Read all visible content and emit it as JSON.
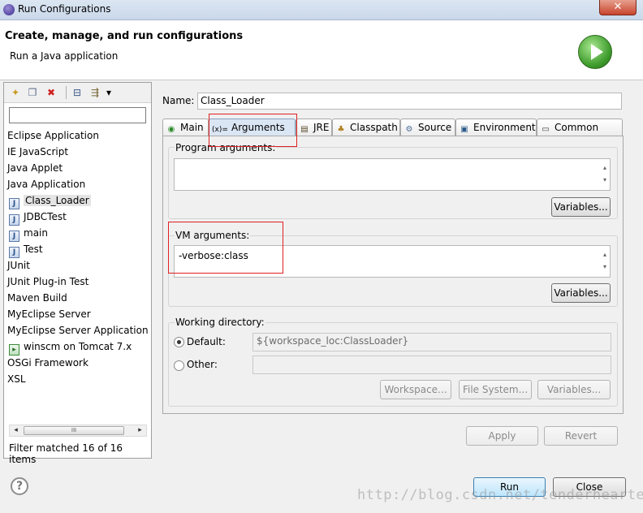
{
  "window": {
    "title": "Run Configurations",
    "close_glyph": "✕",
    "close_icon": "close-icon"
  },
  "banner": {
    "heading": "Create, manage, and run configurations",
    "subtitle": "Run a Java application",
    "icon": "run-icon"
  },
  "left_toolbar": {
    "new_glyph": "✦",
    "duplicate_glyph": "❐",
    "delete_glyph": "✖",
    "collapse_glyph": "⊟",
    "filter_glyph": "⇶",
    "dropdown_glyph": "▾"
  },
  "filter_input": {
    "value": "",
    "placeholder": ""
  },
  "tree": [
    {
      "label": "Eclipse Application",
      "icon": null,
      "selected": false
    },
    {
      "label": "IE JavaScript",
      "icon": null,
      "selected": false
    },
    {
      "label": "Java Applet",
      "icon": null,
      "selected": false
    },
    {
      "label": "Java Application",
      "icon": null,
      "selected": false
    },
    {
      "label": "Class_Loader",
      "icon": "java-class-icon",
      "selected": true
    },
    {
      "label": "JDBCTest",
      "icon": "java-class-icon",
      "selected": false
    },
    {
      "label": "main",
      "icon": "java-class-icon",
      "selected": false
    },
    {
      "label": "Test",
      "icon": "java-class-icon",
      "selected": false
    },
    {
      "label": "JUnit",
      "icon": null,
      "selected": false
    },
    {
      "label": "JUnit Plug-in Test",
      "icon": null,
      "selected": false
    },
    {
      "label": "Maven Build",
      "icon": null,
      "selected": false
    },
    {
      "label": "MyEclipse Server",
      "icon": null,
      "selected": false
    },
    {
      "label": "MyEclipse Server Application",
      "icon": null,
      "selected": false
    },
    {
      "label": "winscm on Tomcat  7.x",
      "icon": "server-icon",
      "selected": false
    },
    {
      "label": "OSGi Framework",
      "icon": null,
      "selected": false
    },
    {
      "label": "XSL",
      "icon": null,
      "selected": false
    }
  ],
  "scrollbar": {
    "left_arrow": "◂",
    "right_arrow": "▸",
    "thumb_grip": "III"
  },
  "filter_status": "Filter matched 16 of 16 items",
  "name_field": {
    "label": "Name:",
    "value": "Class_Loader"
  },
  "tabs": [
    {
      "label": "Main",
      "icon_glyph": "◉",
      "icon": "main-icon",
      "active": false
    },
    {
      "label": "Arguments",
      "icon_glyph": "(x)=",
      "icon": "arguments-icon",
      "active": true
    },
    {
      "label": "JRE",
      "icon_glyph": "▤",
      "icon": "jre-icon",
      "active": false
    },
    {
      "label": "Classpath",
      "icon_glyph": "♣",
      "icon": "classpath-icon",
      "active": false
    },
    {
      "label": "Source",
      "icon_glyph": "⚙",
      "icon": "source-icon",
      "active": false
    },
    {
      "label": "Environment",
      "icon_glyph": "▣",
      "icon": "environment-icon",
      "active": false
    },
    {
      "label": "Common",
      "icon_glyph": "▭",
      "icon": "common-icon",
      "active": false
    }
  ],
  "arguments": {
    "program_label": "Program arguments:",
    "program_value": "",
    "program_variables_button": "Variables...",
    "vm_label": "VM arguments:",
    "vm_value": "-verbose:class",
    "vm_variables_button": "Variables...",
    "scroll_up": "▴",
    "scroll_down": "▾"
  },
  "working_directory": {
    "label": "Working directory:",
    "default_label": "Default:",
    "default_value": "${workspace_loc:ClassLoader}",
    "other_label": "Other:",
    "other_value": "",
    "selected": "default",
    "workspace_button": "Workspace...",
    "filesystem_button": "File System...",
    "variables_button": "Variables..."
  },
  "actions": {
    "apply": "Apply",
    "revert": "Revert",
    "run": "Run",
    "close": "Close"
  },
  "help_glyph": "?",
  "watermark": "http://blog.csdn.net/tenderhearted"
}
